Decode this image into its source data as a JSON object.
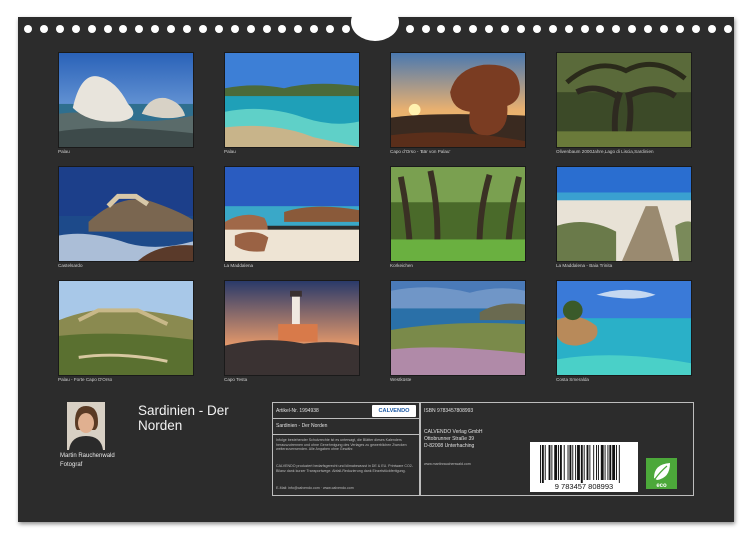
{
  "calendar": {
    "title": "Sardinien - Der Norden",
    "author_name": "Martin Rauchenwald",
    "author_role": "Fotograf"
  },
  "photos": [
    {
      "caption": "Palau",
      "icon": "granite-rock-icon"
    },
    {
      "caption": "Palau",
      "icon": "lagoon-icon"
    },
    {
      "caption": "Capo d'Orso - 'Bär von Palau'",
      "icon": "sunset-rock-icon"
    },
    {
      "caption": "Olivenbaum 2000Jahre,Lago di Liscia,Sardinien",
      "icon": "olive-tree-icon"
    },
    {
      "caption": "Castelsardo",
      "icon": "coastal-town-icon"
    },
    {
      "caption": "La Maddalena",
      "icon": "beach-icon"
    },
    {
      "caption": "Korkeichen",
      "icon": "forest-icon"
    },
    {
      "caption": "La Maddalena - Baia Trinita",
      "icon": "boardwalk-icon"
    },
    {
      "caption": "Palau - Forte Capo D'Orso",
      "icon": "fortress-icon"
    },
    {
      "caption": "Capo Testa",
      "icon": "lighthouse-icon"
    },
    {
      "caption": "Westküste",
      "icon": "coast-flowers-icon"
    },
    {
      "caption": "Costa Smeralda",
      "icon": "turquoise-bay-icon"
    }
  ],
  "info": {
    "article_nr": "Artikel-Nr. 1994938",
    "calvendo_logo": "CALVENDO",
    "title_small": "Sardinien - Der Norden",
    "legal_1": "Infolge bestehender Schutzrechte ist es untersagt, die Blätter dieses Kalenders herauszutrennen und ohne Genehmigung des Verlages zu gewerblichen Zwecken weiterzuverwenden. Alle Angaben ohne Gewähr.",
    "legal_2": "CALVENDO produziert bedarfsgerecht und klimabewusst in DE & EU. Printware CO2-Bilanz dank kurzer Transportwege. Abfall-Reduzierung dank Einzelstückfertigung.",
    "email_line": "E-Mail: info@calvendo.com · www.calvendo.com",
    "isbn": "ISBN 9783457808993",
    "publisher": "CALVENDO Verlag GmbH",
    "street": "Ottobrunner Straße 39",
    "city": "D-82008 Unterhaching",
    "website": "www.martinrauchenwald.com",
    "barcode_number": "9 783457 808993",
    "eco_label": "eco"
  },
  "colors": {
    "sheet_background": "#2c2c2c",
    "eco_green": "#4ca83a",
    "calvendo_blue": "#1c5aa6"
  }
}
